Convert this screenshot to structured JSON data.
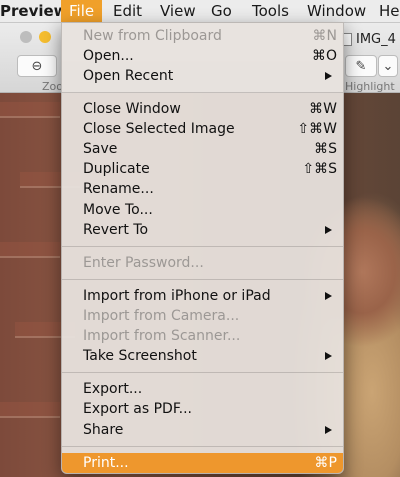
{
  "menubar": {
    "app_name": "Preview",
    "items": [
      "File",
      "Edit",
      "View",
      "Go",
      "Tools",
      "Window",
      "He"
    ]
  },
  "toolbar": {
    "zoom_label": "Zoo",
    "highlight_label": "Highlight",
    "document_title": "IMG_4",
    "zoom_icon_glyph": "⊖",
    "pen_icon_glyph": "✎",
    "chevron_glyph": "⌄"
  },
  "file_menu": {
    "items": [
      {
        "label": "New from Clipboard",
        "shortcut": "⌘N",
        "enabled": false
      },
      {
        "label": "Open...",
        "shortcut": "⌘O",
        "enabled": true
      },
      {
        "label": "Open Recent",
        "shortcut": "",
        "enabled": true,
        "submenu": true
      },
      {
        "label": "Close Window",
        "shortcut": "⌘W",
        "enabled": true
      },
      {
        "label": "Close Selected Image",
        "shortcut": "⇧⌘W",
        "enabled": true
      },
      {
        "label": "Save",
        "shortcut": "⌘S",
        "enabled": true
      },
      {
        "label": "Duplicate",
        "shortcut": "⇧⌘S",
        "enabled": true
      },
      {
        "label": "Rename...",
        "shortcut": "",
        "enabled": true
      },
      {
        "label": "Move To...",
        "shortcut": "",
        "enabled": true
      },
      {
        "label": "Revert To",
        "shortcut": "",
        "enabled": true,
        "submenu": true
      },
      {
        "label": "Enter Password...",
        "shortcut": "",
        "enabled": false
      },
      {
        "label": "Import from iPhone or iPad",
        "shortcut": "",
        "enabled": true,
        "submenu": true
      },
      {
        "label": "Import from Camera...",
        "shortcut": "",
        "enabled": false
      },
      {
        "label": "Import from Scanner...",
        "shortcut": "",
        "enabled": false
      },
      {
        "label": "Take Screenshot",
        "shortcut": "",
        "enabled": true,
        "submenu": true
      },
      {
        "label": "Export...",
        "shortcut": "",
        "enabled": true
      },
      {
        "label": "Export as PDF...",
        "shortcut": "",
        "enabled": true
      },
      {
        "label": "Share",
        "shortcut": "",
        "enabled": true,
        "submenu": true
      },
      {
        "label": "Print...",
        "shortcut": "⌘P",
        "enabled": true,
        "highlighted": true
      }
    ]
  },
  "colors": {
    "menu_highlight": "#ee972d",
    "menubar_selected": "#f0a02a",
    "disabled_text": "#9c9895"
  }
}
